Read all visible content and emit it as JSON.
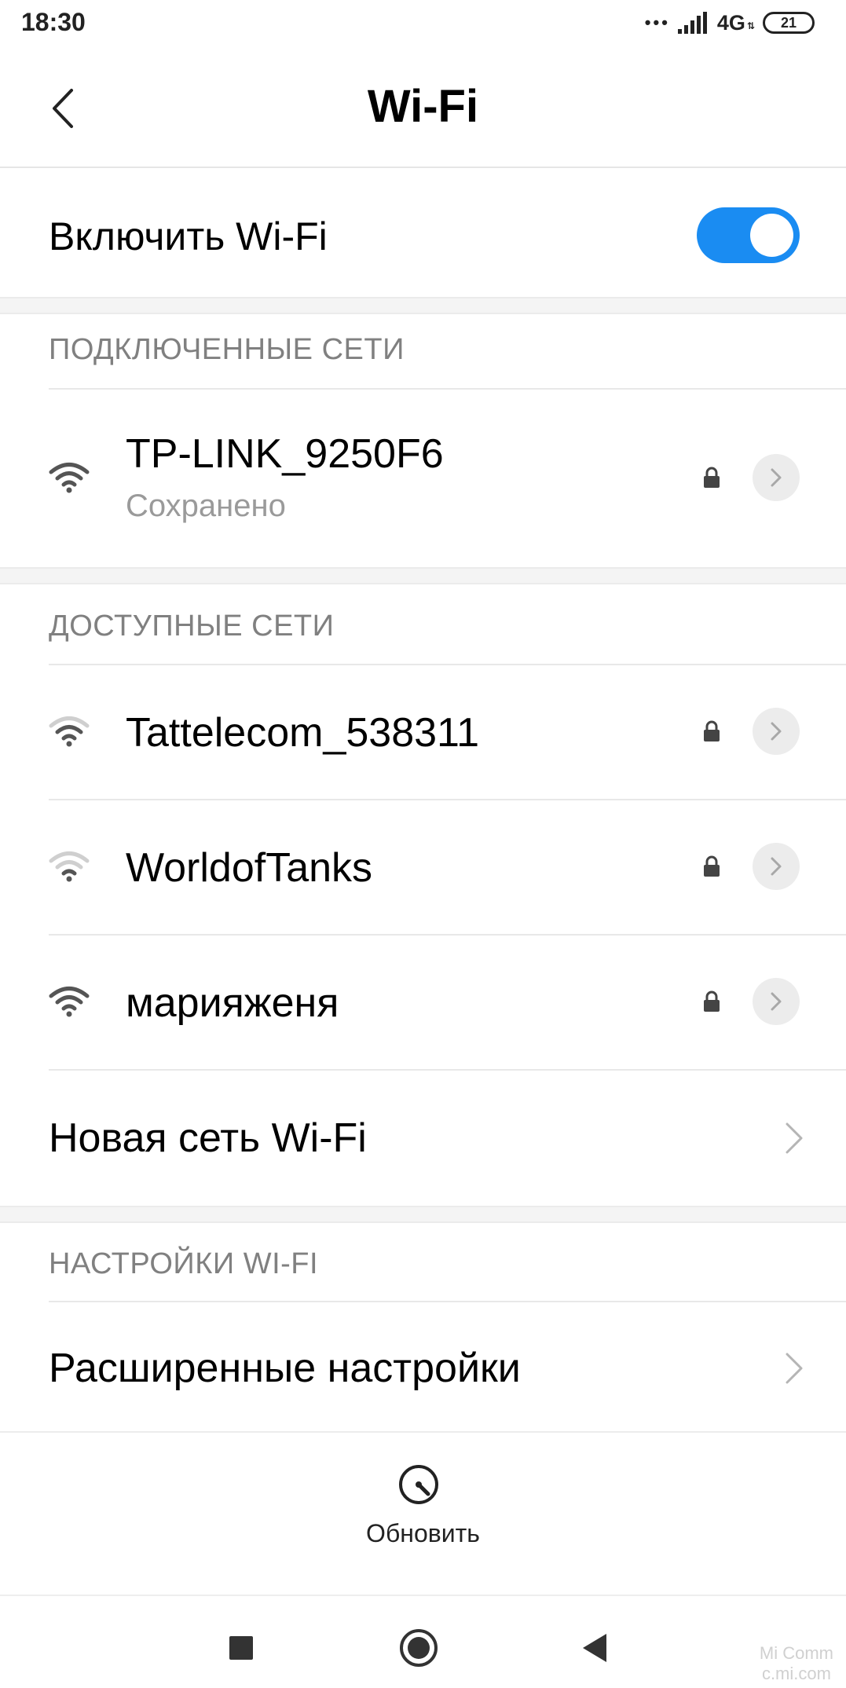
{
  "status_bar": {
    "time": "18:30",
    "network": "4G",
    "battery": "21"
  },
  "header": {
    "title": "Wi-Fi"
  },
  "wifi_toggle": {
    "label": "Включить Wi-Fi",
    "enabled": true
  },
  "sections": {
    "connected": "ПОДКЛЮЧЕННЫЕ СЕТИ",
    "available": "ДОСТУПНЫЕ СЕТИ",
    "settings": "НАСТРОЙКИ WI-FI"
  },
  "connected_network": {
    "name": "TP-LINK_9250F6",
    "status": "Сохранено"
  },
  "available_networks": [
    {
      "name": "Tattelecom_538311"
    },
    {
      "name": "WorldofTanks"
    },
    {
      "name": "марияженя"
    }
  ],
  "new_network_label": "Новая сеть Wi-Fi",
  "advanced_settings_label": "Расширенные настройки",
  "refresh_label": "Обновить",
  "watermark": {
    "line1": "Mi Comm",
    "line2": "c.mi.com"
  },
  "colors": {
    "accent": "#1a8cf2",
    "section_text": "#808080",
    "secondary_text": "#9a9a9a"
  }
}
